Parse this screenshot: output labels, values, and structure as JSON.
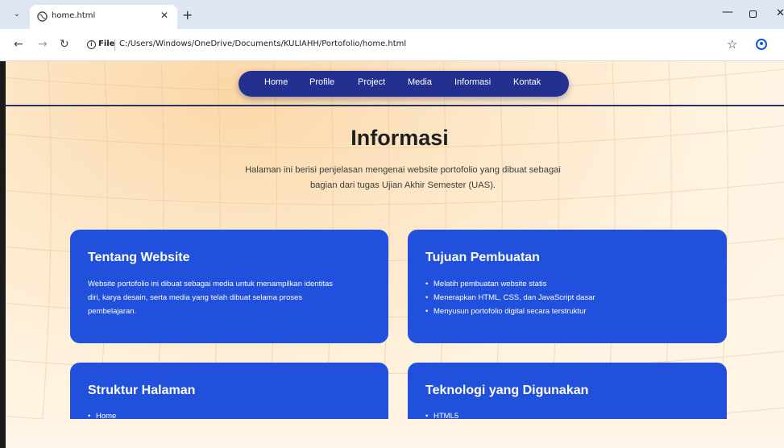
{
  "browser": {
    "tab_title": "home.html",
    "new_tab_label": "+",
    "url_scheme_label": "File",
    "url": "C:/Users/Windows/OneDrive/Documents/KULIAHH/Portofolio/home.html",
    "icons": [
      "tab-list-icon",
      "globe-icon",
      "close-icon",
      "back-icon",
      "forward-icon",
      "reload-icon",
      "info-icon",
      "star-icon",
      "profile-icon",
      "minimize-icon",
      "restore-icon"
    ]
  },
  "nav": {
    "items": [
      "Home",
      "Profile",
      "Project",
      "Media",
      "Informasi",
      "Kontak"
    ]
  },
  "hero": {
    "title": "Informasi",
    "description_line1": "Halaman ini berisi penjelasan mengenai website portofolio yang dibuat sebagai",
    "description_line2": "bagian dari tugas Ujian Akhir Semester (UAS)."
  },
  "cards": {
    "tentang": {
      "title": "Tentang Website",
      "line1": "Website portofolio ini dibuat sebagai media untuk menampilkan identitas",
      "line2": "diri, karya desain, serta media yang telah dibuat selama proses",
      "line3": "pembelajaran."
    },
    "tujuan": {
      "title": "Tujuan Pembuatan",
      "items": [
        "Melatih pembuatan website statis",
        "Menerapkan HTML, CSS, dan JavaScript dasar",
        "Menyusun portofolio digital secara terstruktur"
      ]
    },
    "struktur": {
      "title": "Struktur Halaman",
      "items": [
        "Home"
      ]
    },
    "teknologi": {
      "title": "Teknologi yang Digunakan",
      "items": [
        "HTML5"
      ]
    }
  },
  "colors": {
    "card_bg": "#2150dc",
    "nav_bg": "#24308f",
    "page_bg": "#fde6c6"
  }
}
